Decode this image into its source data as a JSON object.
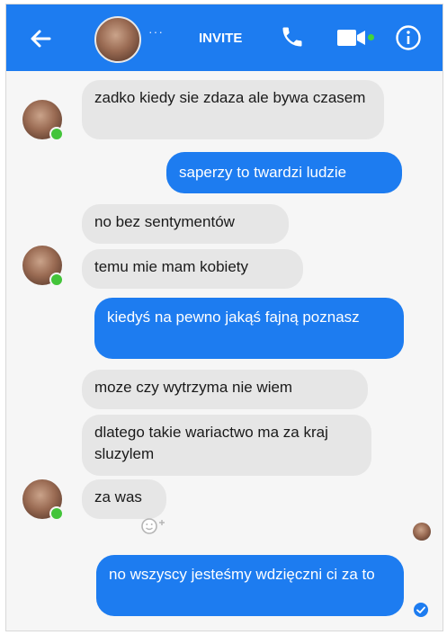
{
  "header": {
    "status_dots": "···",
    "invite_label": "INVITE"
  },
  "messages": [
    {
      "from": "them",
      "text": "zadko kiedy sie   zdaza  ale bywa czasem"
    },
    {
      "from": "me",
      "text": "saperzy to twardzi ludzie"
    },
    {
      "from": "them",
      "text": "no bez  sentymentów"
    },
    {
      "from": "them",
      "text": "temu mie mam kobiety"
    },
    {
      "from": "me",
      "text": "kiedyś na pewno jakąś fajną poznasz"
    },
    {
      "from": "them",
      "text": "moze  czy wytrzyma  nie  wiem"
    },
    {
      "from": "them",
      "text": "dlatego takie  wariactwo ma  za kraj sluzylem"
    },
    {
      "from": "them",
      "text": "za  was"
    },
    {
      "from": "me",
      "text": "no wszyscy jesteśmy wdzięczni ci za to"
    }
  ],
  "colors": {
    "brand_blue": "#1d7cf0",
    "incoming_bubble": "#e6e6e6",
    "online_green": "#43c43a"
  },
  "icons": [
    "back-arrow-icon",
    "phone-icon",
    "video-camera-icon",
    "info-icon",
    "add-reaction-icon",
    "delivered-check-icon"
  ]
}
